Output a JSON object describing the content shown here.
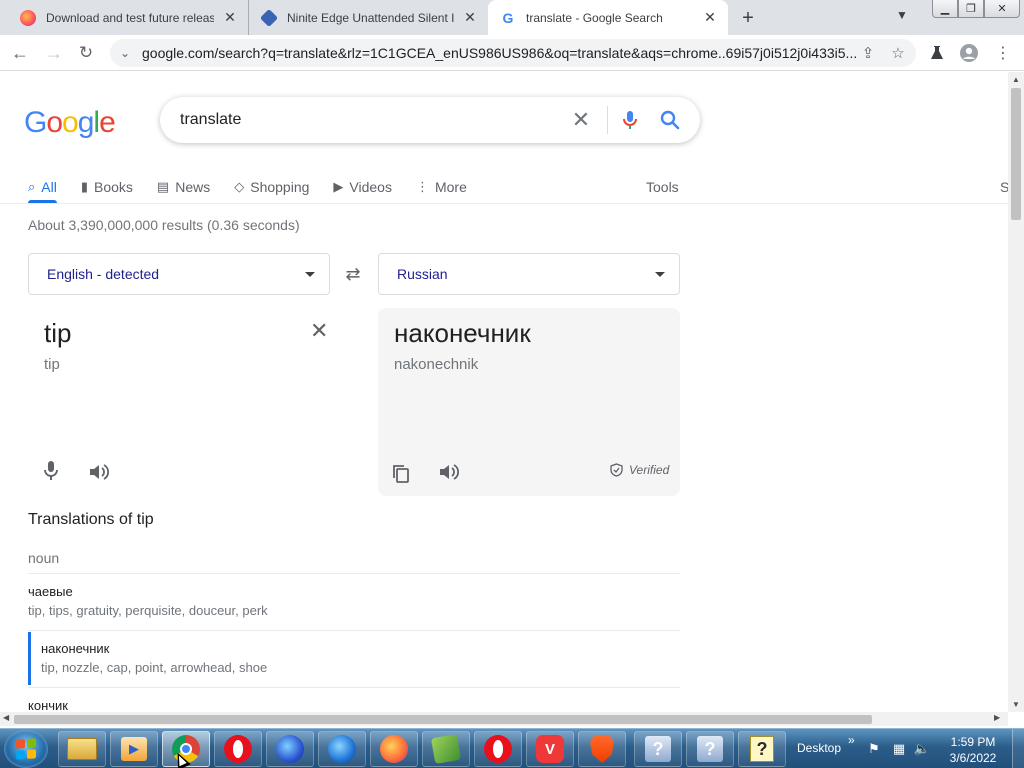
{
  "browser": {
    "tabs": [
      {
        "title": "Download and test future release",
        "favicon": "firefox-icon"
      },
      {
        "title": "Ninite Edge Unattended Silent In",
        "favicon": "ninite-icon"
      },
      {
        "title": "translate - Google Search",
        "favicon": "google-icon",
        "active": true
      }
    ],
    "url": "google.com/search?q=translate&rlz=1C1GCEA_enUS986US986&oq=translate&aqs=chrome..69i57j0i512j0i433i5..."
  },
  "google": {
    "logo": [
      "G",
      "o",
      "o",
      "g",
      "l",
      "e"
    ],
    "logo_colors": [
      "#4285F4",
      "#EA4335",
      "#FBBC05",
      "#4285F4",
      "#34A853",
      "#EA4335"
    ],
    "query": "translate",
    "nav": [
      {
        "label": "All",
        "icon": "search-icon",
        "active": true
      },
      {
        "label": "Books",
        "icon": "book-icon"
      },
      {
        "label": "News",
        "icon": "news-icon"
      },
      {
        "label": "Shopping",
        "icon": "tag-icon"
      },
      {
        "label": "Videos",
        "icon": "play-icon"
      },
      {
        "label": "More",
        "icon": "more-vert-icon"
      }
    ],
    "tools": "Tools",
    "right_truncated": "S",
    "stats": "About 3,390,000,000 results (0.36 seconds)"
  },
  "translator": {
    "source_lang": "English - detected",
    "target_lang": "Russian",
    "source_text": "tip",
    "source_romanization": "tip",
    "target_text": "наконечник",
    "target_romanization": "nakonechnik",
    "verified": "Verified",
    "section_title": "Translations of tip",
    "part_of_speech": "noun",
    "entries": [
      {
        "word": "чаевые",
        "synonyms": "tip, tips, gratuity, perquisite, douceur, perk"
      },
      {
        "word": "наконечник",
        "synonyms": "tip, nozzle, cap, point, arrowhead, shoe",
        "selected": true
      },
      {
        "word": "кончик",
        "synonyms": ""
      }
    ]
  },
  "taskbar": {
    "desktop_label": "Desktop",
    "time": "1:59 PM",
    "date": "3/6/2022"
  },
  "colors": {
    "accent": "#1a73e8",
    "google_blue": "#4285F4",
    "google_red": "#EA4335",
    "google_yellow": "#FBBC05",
    "google_green": "#34A853"
  }
}
